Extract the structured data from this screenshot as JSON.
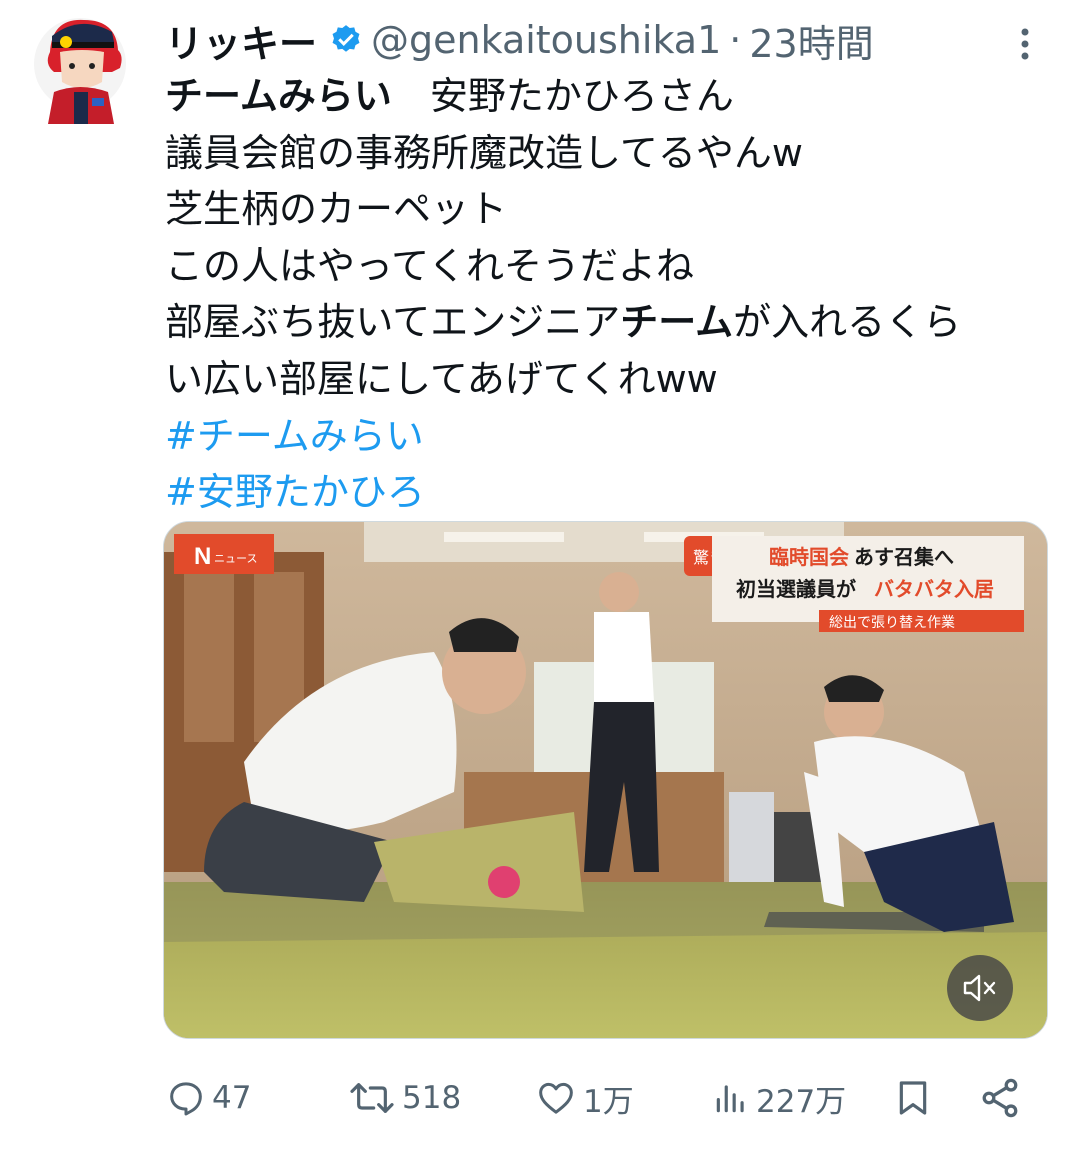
{
  "tweet": {
    "author_name": "リッキー",
    "handle": "@genkaitoushika1",
    "separator": "·",
    "time": "23時間",
    "lines": [
      [
        {
          "t": "チームみらい",
          "b": true
        },
        {
          "t": "　安野たかひろさん",
          "b": false
        }
      ],
      [
        {
          "t": "議員会館の事務所魔改造してるやんw",
          "b": false
        }
      ],
      [
        {
          "t": "芝生柄のカーペット",
          "b": false
        }
      ],
      [
        {
          "t": "この人はやってくれそうだよね",
          "b": false
        }
      ],
      [
        {
          "t": "部屋ぶち抜いてエンジニア",
          "b": false
        },
        {
          "t": "チーム",
          "b": true
        },
        {
          "t": "が入れるくら",
          "b": false
        }
      ],
      [
        {
          "t": "い広い部屋にしてあげてくれww",
          "b": false
        }
      ]
    ],
    "hashtags": [
      "#チームみらい",
      "#安野たかひろ"
    ]
  },
  "video": {
    "logo": "N",
    "logo_sub": "ニュース",
    "badge": "驚き",
    "caption_line1_a": "臨時国会",
    "caption_line1_b": "あす召集へ",
    "caption_line2_a": "初当選議員が",
    "caption_line2_b": "バタバタ入居",
    "caption_line3": "総出で張り替え作業",
    "mute_icon": "speaker-muted-icon"
  },
  "actions": {
    "replies": "47",
    "retweets": "518",
    "likes": "1万",
    "views": "227万"
  },
  "colors": {
    "text": "#0f1419",
    "secondary": "#536471",
    "link": "#1d9bf0",
    "verified": "#1d9bf0"
  }
}
